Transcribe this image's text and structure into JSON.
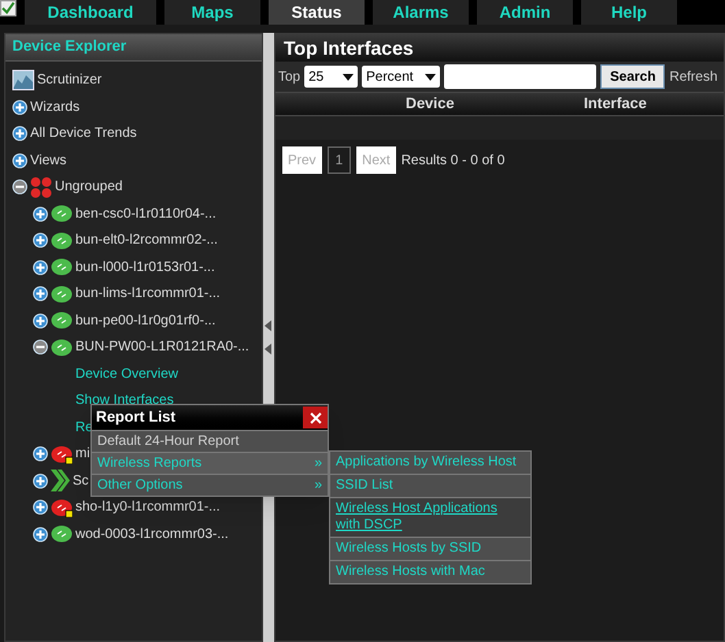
{
  "nav": {
    "tabs": [
      {
        "label": "Dashboard",
        "selected": false
      },
      {
        "label": "Maps",
        "selected": false
      },
      {
        "label": "Status",
        "selected": true
      },
      {
        "label": "Alarms",
        "selected": false
      },
      {
        "label": "Admin",
        "selected": false
      },
      {
        "label": "Help",
        "selected": false
      }
    ]
  },
  "sidebar": {
    "title": "Device Explorer",
    "tree": [
      {
        "label": "Scrutinizer",
        "kind": "root"
      },
      {
        "label": "Wizards",
        "kind": "folder",
        "expanded": false
      },
      {
        "label": "All Device Trends",
        "kind": "folder",
        "expanded": false
      },
      {
        "label": "Views",
        "kind": "folder",
        "expanded": false
      },
      {
        "label": "Ungrouped",
        "kind": "group",
        "expanded": true,
        "children": [
          {
            "label": "ben-csc0-l1r0110r04-...",
            "kind": "device",
            "color": "#4cbb4c",
            "alert": false,
            "expanded": false
          },
          {
            "label": "bun-elt0-l2rcommr02-...",
            "kind": "device",
            "color": "#4cbb4c",
            "alert": false,
            "expanded": false
          },
          {
            "label": "bun-l000-l1r0153r01-...",
            "kind": "device",
            "color": "#4cbb4c",
            "alert": false,
            "expanded": false
          },
          {
            "label": "bun-lims-l1rcommr01-...",
            "kind": "device",
            "color": "#4cbb4c",
            "alert": false,
            "expanded": false
          },
          {
            "label": "bun-pe00-l1r0g01rf0-...",
            "kind": "device",
            "color": "#4cbb4c",
            "alert": false,
            "expanded": false
          },
          {
            "label": "BUN-PW00-L1R0121RA0-...",
            "kind": "device",
            "color": "#4cbb4c",
            "alert": false,
            "expanded": true,
            "children": [
              {
                "label": "Device Overview",
                "kind": "link"
              },
              {
                "label": "Show Interfaces",
                "kind": "link"
              },
              {
                "label": "Re",
                "kind": "link"
              }
            ]
          },
          {
            "label": "mi",
            "kind": "device",
            "color": "#e02020",
            "alert": true,
            "expanded": false
          },
          {
            "label": "Sc",
            "kind": "arrow",
            "expanded": false
          },
          {
            "label": "sho-l1y0-l1rcommr01-...",
            "kind": "device",
            "color": "#e02020",
            "alert": true,
            "expanded": false
          },
          {
            "label": "wod-0003-l1rcommr03-...",
            "kind": "device",
            "color": "#4cbb4c",
            "alert": false,
            "expanded": false
          }
        ]
      }
    ]
  },
  "main": {
    "title": "Top Interfaces",
    "top_label": "Top",
    "top_select": "25",
    "unit_select": "Percent",
    "search_button": "Search",
    "refresh": "Refresh",
    "columns": [
      "Device",
      "Interface"
    ],
    "pager": {
      "prev": "Prev",
      "page": "1",
      "next": "Next",
      "results": "Results 0 - 0 of 0"
    }
  },
  "popup": {
    "title": "Report List",
    "items": [
      {
        "label": "Default 24-Hour Report",
        "expanded": false
      },
      {
        "label": "Wireless Reports",
        "arrow": "»",
        "expanded": true
      },
      {
        "label": "Other Options",
        "arrow": "»",
        "expanded": false
      }
    ],
    "submenu": [
      {
        "label": "Applications by Wireless Host",
        "selected": false
      },
      {
        "label": "SSID List",
        "selected": false
      },
      {
        "label": "Wireless Host Applications with DSCP",
        "selected": true
      },
      {
        "label": "Wireless Hosts by SSID",
        "selected": false
      },
      {
        "label": "Wireless Hosts with Mac",
        "selected": false
      }
    ]
  }
}
